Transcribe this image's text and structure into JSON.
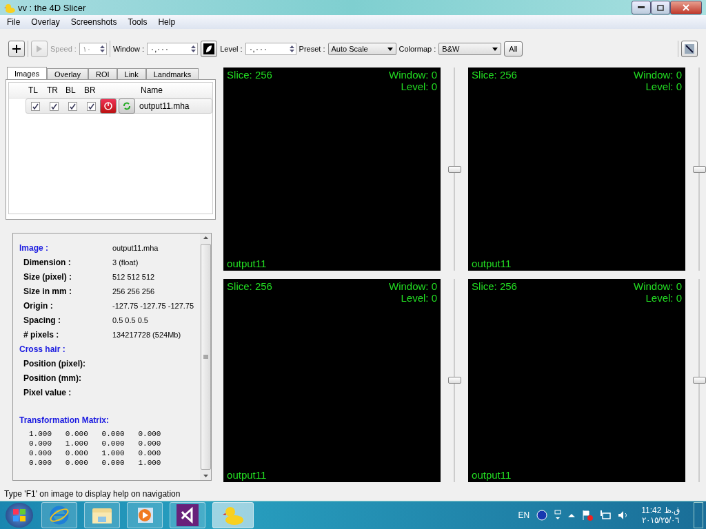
{
  "window": {
    "title": "vv : the 4D Slicer"
  },
  "menu": [
    "File",
    "Overlay",
    "Screenshots",
    "Tools",
    "Help"
  ],
  "toolbar": {
    "speed_label": "Speed :",
    "speed_value": "١٠",
    "window_label": "Window :",
    "window_value": "٠,٠٠٠",
    "level_label": "Level :",
    "level_value": "٠,٠٠٠",
    "preset_label": "Preset :",
    "preset_value": "Auto Scale",
    "colormap_label": "Colormap :",
    "colormap_value": "B&W",
    "all_button": "All"
  },
  "tabs": [
    {
      "label": "Images",
      "selected": true
    },
    {
      "label": "Overlay",
      "selected": false
    },
    {
      "label": "ROI",
      "selected": false
    },
    {
      "label": "Link",
      "selected": false
    },
    {
      "label": "Landmarks",
      "selected": false
    }
  ],
  "image_table": {
    "columns": [
      "TL",
      "TR",
      "BL",
      "BR",
      "Name"
    ],
    "rows": [
      {
        "tl": true,
        "tr": true,
        "bl": true,
        "br": true,
        "name": "output11.mha"
      }
    ]
  },
  "info": [
    {
      "heading": "Image :",
      "value": "output11.mha",
      "rows": [
        {
          "label": "Dimension :",
          "value": "3 (float)"
        },
        {
          "label": "Size (pixel) :",
          "value": "512 512 512"
        },
        {
          "label": "Size in mm :",
          "value": "256 256 256"
        },
        {
          "label": "Origin :",
          "value": "-127.75 -127.75 -127.75"
        },
        {
          "label": "Spacing :",
          "value": "0.5 0.5 0.5"
        },
        {
          "label": "# pixels :",
          "value": "134217728 (524Mb)"
        }
      ]
    },
    {
      "heading": "Cross hair :",
      "rows": [
        {
          "label": "Position (pixel):"
        },
        {
          "label": "Position (mm):"
        },
        {
          "label": "Pixel value :"
        }
      ]
    }
  ],
  "matrix": {
    "heading": "Transformation Matrix:",
    "rows": [
      "1.000   0.000   0.000   0.000",
      "0.000   1.000   0.000   0.000",
      "0.000   0.000   1.000   0.000",
      "0.000   0.000   0.000   1.000"
    ]
  },
  "views": [
    {
      "slice": "Slice: 256",
      "window": "Window: 0",
      "level_text": "Level: 0",
      "name": "output11",
      "level": 0.5
    },
    {
      "slice": "Slice: 256",
      "window": "Window: 0",
      "level_text": "Level: 0",
      "name": "output11",
      "level": 0.5
    },
    {
      "slice": "Slice: 256",
      "window": "Window: 0",
      "level_text": "Level: 0",
      "name": "output11",
      "level": 0.5
    },
    {
      "slice": "Slice: 256",
      "window": "Window: 0",
      "level_text": "Level: 0",
      "name": "output11",
      "level": 0.5
    }
  ],
  "status_bar": "Type 'F1' on image to display help on navigation",
  "taskbar": {
    "apps": [
      {
        "kind": "browser",
        "selected": false
      },
      {
        "kind": "folder",
        "selected": false
      },
      {
        "kind": "player",
        "selected": false
      },
      {
        "kind": "studio",
        "selected": false
      },
      {
        "kind": "duck",
        "selected": true
      }
    ],
    "language": "EN",
    "time": "11:42 ق.ظ",
    "date": "٢٠١٥/٢٥/٠٦"
  }
}
